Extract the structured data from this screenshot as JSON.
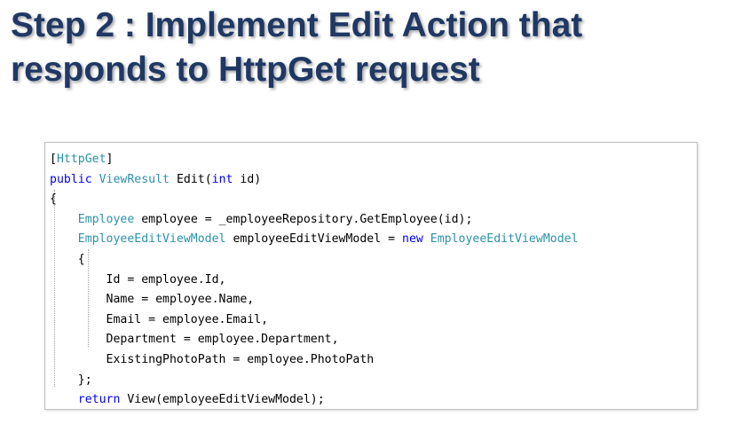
{
  "slide": {
    "title_line1": "Step 2 : Implement Edit Action that",
    "title_line2": "responds to HttpGet request"
  },
  "code": {
    "lines": [
      [
        {
          "t": "[",
          "c": "plain"
        },
        {
          "t": "HttpGet",
          "c": "type"
        },
        {
          "t": "]",
          "c": "plain"
        }
      ],
      [
        {
          "t": "public",
          "c": "kw"
        },
        {
          "t": " ",
          "c": "plain"
        },
        {
          "t": "ViewResult",
          "c": "type"
        },
        {
          "t": " Edit(",
          "c": "plain"
        },
        {
          "t": "int",
          "c": "kw"
        },
        {
          "t": " id)",
          "c": "plain"
        }
      ],
      [
        {
          "t": "{",
          "c": "plain"
        }
      ],
      [
        {
          "t": "    ",
          "c": "plain"
        },
        {
          "t": "Employee",
          "c": "type"
        },
        {
          "t": " employee = _employeeRepository.GetEmployee(id);",
          "c": "plain"
        }
      ],
      [
        {
          "t": "    ",
          "c": "plain"
        },
        {
          "t": "EmployeeEditViewModel",
          "c": "type"
        },
        {
          "t": " employeeEditViewModel = ",
          "c": "plain"
        },
        {
          "t": "new",
          "c": "kw"
        },
        {
          "t": " ",
          "c": "plain"
        },
        {
          "t": "EmployeeEditViewModel",
          "c": "type"
        }
      ],
      [
        {
          "t": "    {",
          "c": "plain"
        }
      ],
      [
        {
          "t": "        Id = employee.Id,",
          "c": "plain"
        }
      ],
      [
        {
          "t": "        Name = employee.Name,",
          "c": "plain"
        }
      ],
      [
        {
          "t": "        Email = employee.Email,",
          "c": "plain"
        }
      ],
      [
        {
          "t": "        Department = employee.Department,",
          "c": "plain"
        }
      ],
      [
        {
          "t": "        ExistingPhotoPath = employee.PhotoPath",
          "c": "plain"
        }
      ],
      [
        {
          "t": "    };",
          "c": "plain"
        }
      ],
      [
        {
          "t": "    ",
          "c": "plain"
        },
        {
          "t": "return",
          "c": "kw"
        },
        {
          "t": " View(employeeEditViewModel);",
          "c": "plain"
        }
      ],
      [
        {
          "t": "}",
          "c": "plain"
        }
      ]
    ]
  },
  "colors": {
    "title": "#1f3864",
    "keyword": "#0000ff",
    "type": "#2b91af",
    "text": "#000000"
  }
}
